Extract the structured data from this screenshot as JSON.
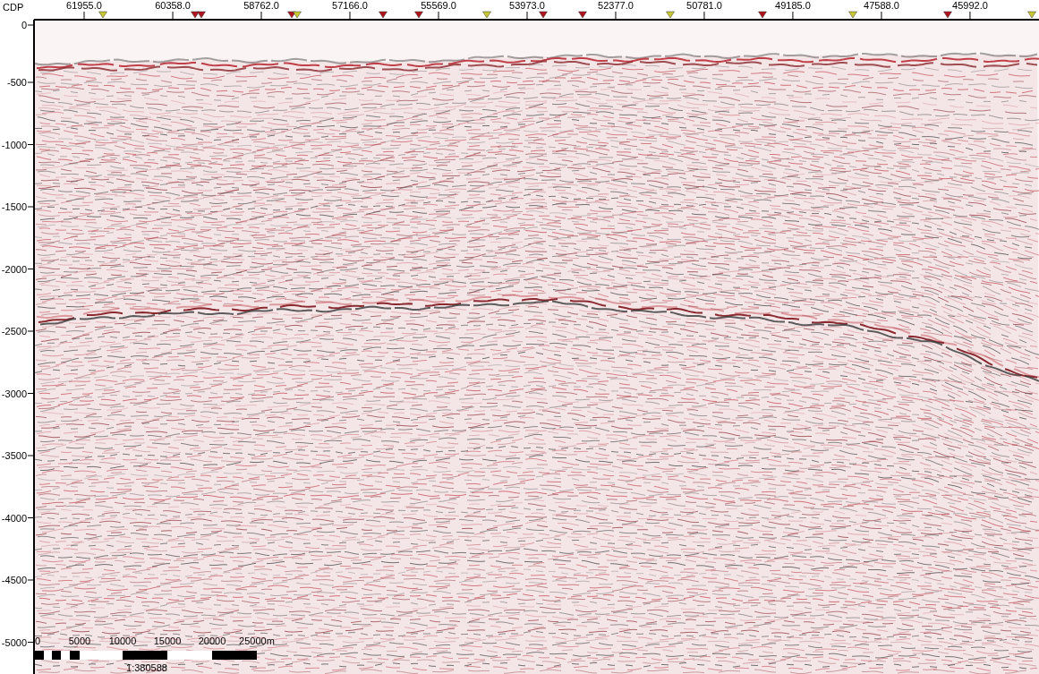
{
  "top_axis": {
    "label": "CDP",
    "ticks": [
      "61955.0",
      "60358.0",
      "58762.0",
      "57166.0",
      "55569.0",
      "53973.0",
      "52377.0",
      "50781.0",
      "49185.0",
      "47588.0",
      "45992.0"
    ],
    "markers": [
      {
        "color": "#c8c832"
      },
      {
        "color": "#b0141e"
      },
      {
        "color": "#b0141e"
      },
      {
        "color": "#b0141e"
      },
      {
        "color": "#c8c832"
      },
      {
        "color": "#b0141e"
      },
      {
        "color": "#b0141e"
      },
      {
        "color": "#c8c832"
      },
      {
        "color": "#b0141e"
      },
      {
        "color": "#b0141e"
      },
      {
        "color": "#c8c832"
      },
      {
        "color": "#b0141e"
      },
      {
        "color": "#c8c832"
      },
      {
        "color": "#b0141e"
      },
      {
        "color": "#c8c832"
      }
    ]
  },
  "left_axis": {
    "ticks": [
      "0",
      "-500",
      "-1000",
      "-1500",
      "-2000",
      "-2500",
      "-3000",
      "-3500",
      "-4000",
      "-4500",
      "-5000"
    ]
  },
  "scale_bar": {
    "labels": [
      "0",
      "5000",
      "10000",
      "15000",
      "20000",
      "25000m"
    ],
    "ratio": "1:380588"
  }
}
